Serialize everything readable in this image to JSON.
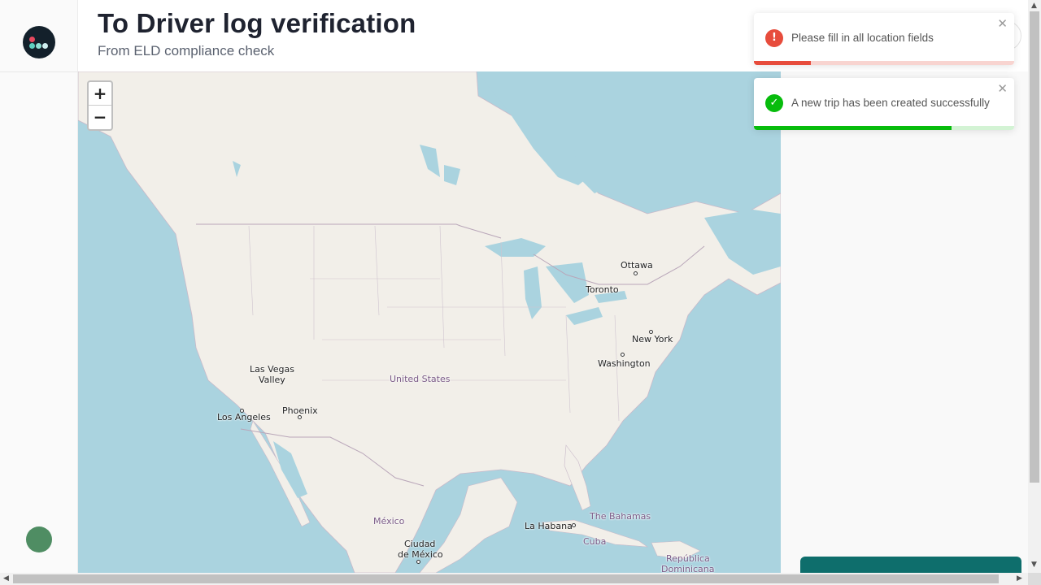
{
  "header": {
    "title": "To Driver log verification",
    "subtitle": "From ELD compliance check"
  },
  "map": {
    "zoom_in_label": "+",
    "zoom_out_label": "−",
    "labels": {
      "ottawa": "Ottawa",
      "toronto": "Toronto",
      "new_york": "New York",
      "washington": "Washington",
      "las_vegas_1": "Las Vegas",
      "las_vegas_2": "Valley",
      "united_states": "United States",
      "phoenix": "Phoenix",
      "los_angeles": "Los Angeles",
      "mexico": "México",
      "ciudad_1": "Ciudad",
      "ciudad_2": "de México",
      "la_habana": "La Habana",
      "bahamas": "The Bahamas",
      "cuba": "Cuba",
      "dominicana_1": "República",
      "dominicana_2": "Dominicana"
    }
  },
  "toasts": [
    {
      "type": "error",
      "icon": "!",
      "message": "Please fill in all location fields",
      "close": "✕",
      "progress": 0.22,
      "color": "#e74c3c"
    },
    {
      "type": "success",
      "icon": "✓",
      "message": "A new trip has been created successfully",
      "close": "✕",
      "progress": 0.76,
      "color": "#07bc0c"
    }
  ],
  "colors": {
    "water": "#aad3df",
    "land": "#f2efe9",
    "teal": "#0e6e6c"
  }
}
